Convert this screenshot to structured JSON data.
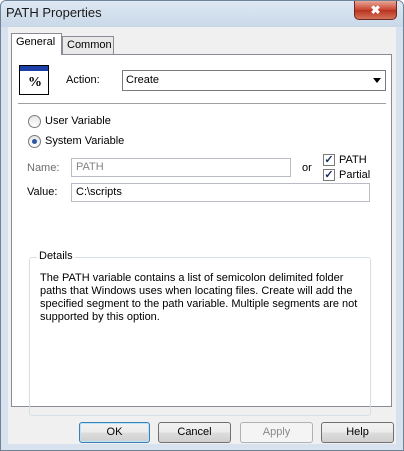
{
  "window": {
    "title": "PATH Properties",
    "close_label": "✖"
  },
  "tabs": [
    {
      "label": "General",
      "active": true
    },
    {
      "label": "Common",
      "active": false
    }
  ],
  "action": {
    "icon_glyph": "%",
    "label": "Action:",
    "value": "Create",
    "options": [
      "Create"
    ]
  },
  "variable_type": {
    "options": [
      {
        "label": "User Variable",
        "checked": false
      },
      {
        "label": "System Variable",
        "checked": true
      }
    ]
  },
  "name": {
    "label": "Name:",
    "value": "PATH",
    "or_label": "or",
    "enabled": false
  },
  "checkboxes": [
    {
      "label": "PATH",
      "checked": true
    },
    {
      "label": "Partial",
      "checked": true
    }
  ],
  "value": {
    "label": "Value:",
    "value": "C:\\scripts"
  },
  "details": {
    "title": "Details",
    "text": "The PATH variable contains a list of semicolon delimited folder paths that Windows uses when locating files. Create will add the specified segment to the path variable. Multiple segments are not supported by this option."
  },
  "buttons": {
    "ok": "OK",
    "cancel": "Cancel",
    "apply": "Apply",
    "help": "Help"
  }
}
